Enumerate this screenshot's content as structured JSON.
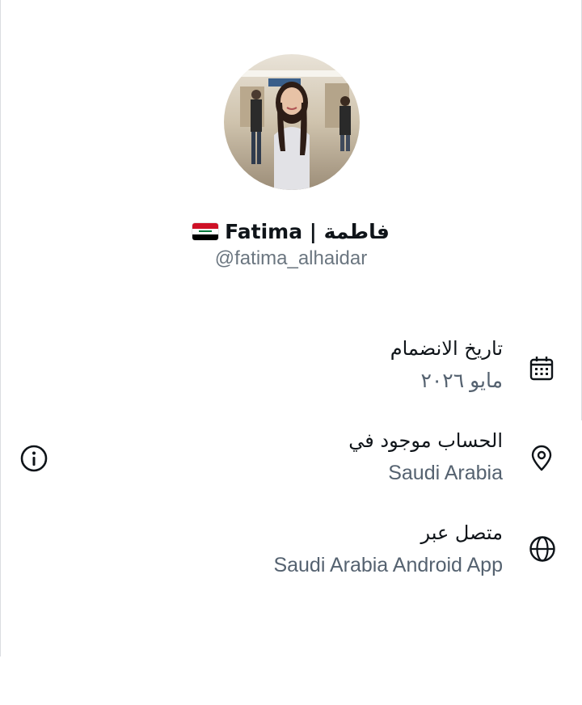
{
  "profile": {
    "display_name": "Fatima | فاطمة",
    "flag_icon": "iraq-flag-icon",
    "handle": "@fatima_alhaidar"
  },
  "about": {
    "joined": {
      "label": "تاريخ الانضمام",
      "value": "مايو ٢٠٢٦",
      "icon": "calendar-icon"
    },
    "location": {
      "label": "الحساب موجود في",
      "value": "Saudi Arabia",
      "icon": "location-pin-icon"
    },
    "connected": {
      "label": "متصل عبر",
      "value": "Saudi Arabia Android App",
      "icon": "globe-icon"
    }
  },
  "info_icon": "info-icon",
  "colors": {
    "text": "#0f1419",
    "muted": "#556270",
    "handle": "#6b7680"
  }
}
